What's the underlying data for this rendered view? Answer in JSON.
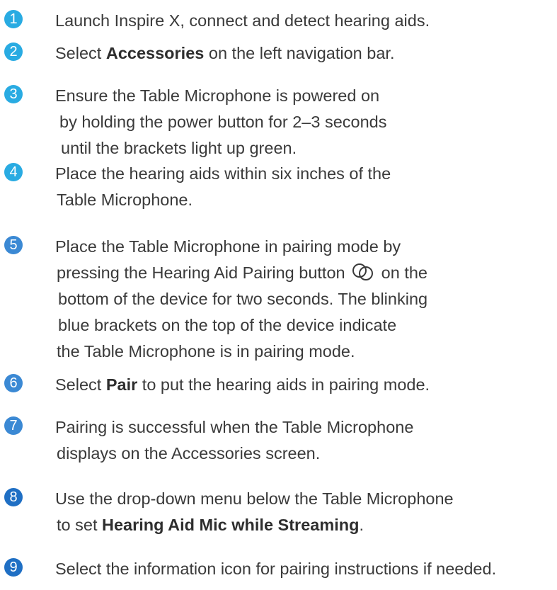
{
  "colors": {
    "text": "#3a3a3a",
    "badge_fill_1": "#29abe2",
    "badge_fill_2": "#3b89d4",
    "badge_fill_3": "#1f6fc4"
  },
  "steps": [
    {
      "number": "1",
      "lines": [
        [
          {
            "t": "Launch Inspire X, connect and detect hearing aids."
          }
        ]
      ]
    },
    {
      "number": "2",
      "lines": [
        [
          {
            "t": "Select "
          },
          {
            "t": "Accessories",
            "b": true
          },
          {
            "t": " on the left navigation bar."
          }
        ]
      ]
    },
    {
      "number": "3",
      "lines": [
        [
          {
            "t": "Ensure the Table Microphone is powered on"
          }
        ],
        [
          {
            "t": "by holding the power button for 2–3 seconds"
          }
        ],
        [
          {
            "t": "until the brackets light up green."
          }
        ]
      ]
    },
    {
      "number": "4",
      "lines": [
        [
          {
            "t": "Place the hearing aids within six inches of the"
          }
        ],
        [
          {
            "t": "Table Microphone."
          }
        ]
      ]
    },
    {
      "number": "5",
      "lines": [
        [
          {
            "t": "Place the Table Microphone in pairing mode by"
          }
        ],
        [
          {
            "t": "pressing the Hearing Aid Pairing button "
          },
          {
            "icon": "pairing-rings-icon"
          },
          {
            "t": " on the"
          }
        ],
        [
          {
            "t": "bottom of the device for two seconds. The blinking"
          }
        ],
        [
          {
            "t": "blue brackets on the top of the device indicate"
          }
        ],
        [
          {
            "t": "the Table Microphone is in pairing mode."
          }
        ]
      ]
    },
    {
      "number": "6",
      "lines": [
        [
          {
            "t": "Select "
          },
          {
            "t": "Pair",
            "b": true
          },
          {
            "t": " to put the hearing aids in pairing mode."
          }
        ]
      ]
    },
    {
      "number": "7",
      "lines": [
        [
          {
            "t": "Pairing is successful when the Table Microphone"
          }
        ],
        [
          {
            "t": "displays on the Accessories screen."
          }
        ]
      ]
    },
    {
      "number": "8",
      "lines": [
        [
          {
            "t": "Use the drop-down menu below the Table Microphone"
          }
        ],
        [
          {
            "t": "to set "
          },
          {
            "t": "Hearing Aid Mic while Streaming",
            "b": true
          },
          {
            "t": "."
          }
        ]
      ]
    },
    {
      "number": "9",
      "lines": [
        [
          {
            "t": "Select the information icon for pairing instructions if needed."
          }
        ]
      ]
    }
  ]
}
